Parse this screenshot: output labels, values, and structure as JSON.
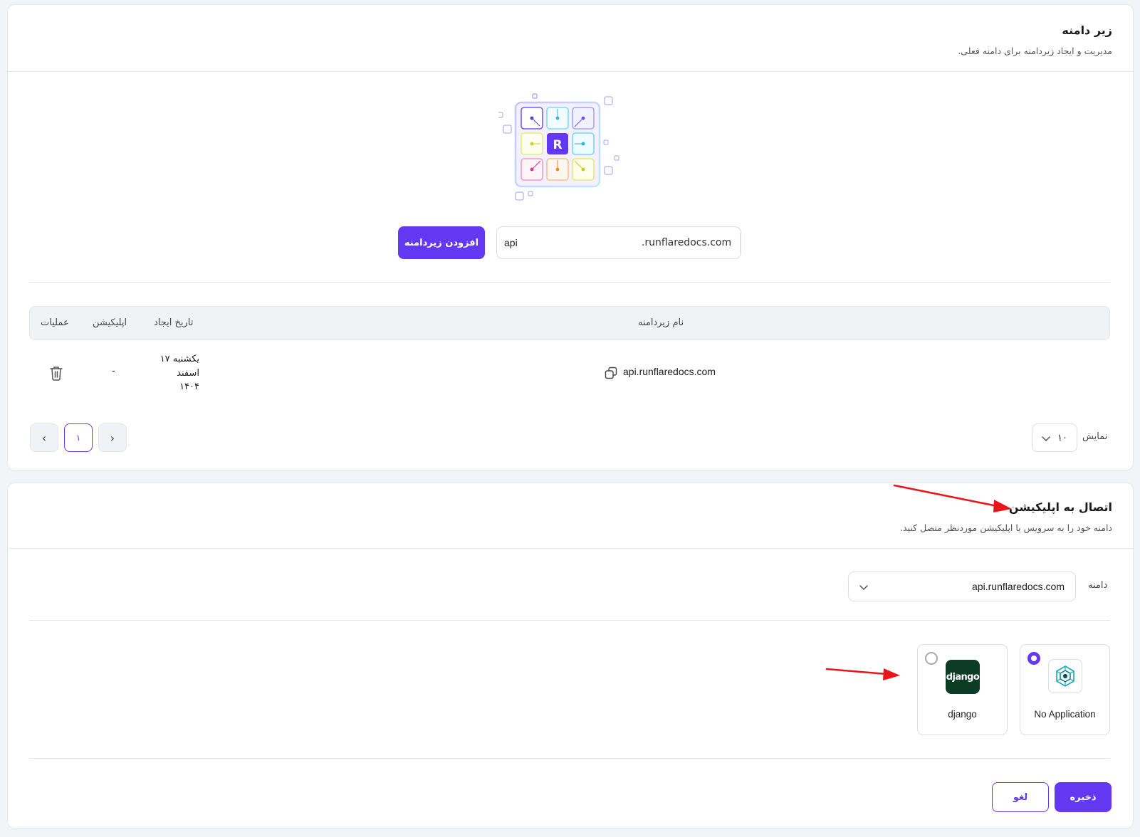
{
  "subdomain_section": {
    "title": "زیر دامنه",
    "subtitle": "مدیریت و ایجاد زیردامنه برای دامنه فعلی.",
    "illustration_letter": "R",
    "domain_suffix": ".runflaredocs.com",
    "input_value": "api",
    "add_button_label": "افزودن زیردامنه",
    "table": {
      "headers": {
        "name": "نام زیردامنه",
        "created": "تاریخ ایجاد",
        "application": "اپلیکیشن",
        "actions": "عملیات"
      },
      "rows": [
        {
          "name": "api.runflaredocs.com",
          "created_line1": "یکشنبه ۱۷",
          "created_line2": "اسفند",
          "created_line3": "۱۴۰۴",
          "application": "-"
        }
      ]
    },
    "pagination": {
      "current_page": "۱",
      "page_size_label": "نمایش",
      "page_size_value": "۱۰"
    }
  },
  "connect_section": {
    "title": "اتصال به اپلیکیشن",
    "subtitle": "دامنه خود را به سرویس یا اپلیکیشن موردنظر متصل کنید.",
    "domain_label": "دامنه",
    "domain_value": "api.runflaredocs.com",
    "apps": [
      {
        "label": "No Application",
        "selected": true,
        "icon": "no-application-icon"
      },
      {
        "label": "django",
        "selected": false,
        "icon": "django-logo",
        "logo_text": "django"
      }
    ],
    "save_label": "ذخیره",
    "cancel_label": "لغو"
  },
  "colors": {
    "primary": "#6238f2",
    "annotation_arrow": "#e8161b",
    "django_green": "#0c3c26"
  }
}
